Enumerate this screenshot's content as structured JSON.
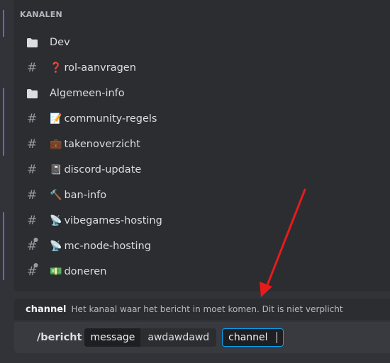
{
  "picker": {
    "section_header": "KANALEN",
    "channels": [
      {
        "icon": "folder-icon",
        "emoji": "",
        "label": "Dev"
      },
      {
        "icon": "hash-icon",
        "emoji": "❓",
        "label": "rol-aanvragen"
      },
      {
        "icon": "folder-icon",
        "emoji": "",
        "label": "Algemeen-info"
      },
      {
        "icon": "hash-icon",
        "emoji": "📝",
        "label": "community-regels"
      },
      {
        "icon": "hash-icon",
        "emoji": "💼",
        "label": "takenoverzicht"
      },
      {
        "icon": "hash-icon",
        "emoji": "📓",
        "label": "discord-update"
      },
      {
        "icon": "hash-icon",
        "emoji": "🔨",
        "label": "ban-info"
      },
      {
        "icon": "hash-icon",
        "emoji": "📡",
        "label": "vibegames-hosting"
      },
      {
        "icon": "hash-lock-icon",
        "emoji": "📡",
        "label": "mc-node-hosting"
      },
      {
        "icon": "hash-lock-icon",
        "emoji": "💵",
        "label": "doneren"
      }
    ]
  },
  "hint": {
    "option_name": "channel",
    "description": "Het kanaal waar het bericht in moet komen. Dit is niet verplicht"
  },
  "composer": {
    "command": "/bericht",
    "filled_option": {
      "label": "message",
      "value": "awdawdawd"
    },
    "active_option": "channel"
  },
  "colors": {
    "accent_blue": "#00a8fc",
    "unread_bar": "#5865f2",
    "annotation_arrow": "#e81b1b"
  }
}
